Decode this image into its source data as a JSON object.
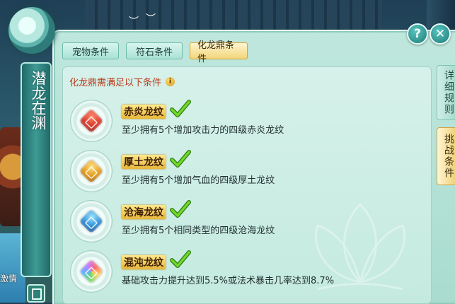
{
  "window": {
    "banner_title": "潜龙在渊"
  },
  "tabs": [
    {
      "label": "宠物条件",
      "active": false
    },
    {
      "label": "符石条件",
      "active": false
    },
    {
      "label": "化龙鼎条件",
      "active": true
    }
  ],
  "side_tabs": [
    {
      "label": "详细规则",
      "active": false
    },
    {
      "label": "挑战条件",
      "active": true
    }
  ],
  "buttons": {
    "help_symbol": "?",
    "close_symbol": "✕"
  },
  "background_text": "激情",
  "heading": {
    "text": "化龙鼎需满足以下条件",
    "info_symbol": "i"
  },
  "conditions": [
    {
      "title": "赤炎龙纹",
      "desc": "至少拥有5个增加攻击力的四级赤炎龙纹",
      "gem_color": "#d8382a",
      "met": true
    },
    {
      "title": "厚土龙纹",
      "desc": "至少拥有5个增加气血的四级厚土龙纹",
      "gem_color": "#e39a16",
      "met": true
    },
    {
      "title": "沧海龙纹",
      "desc": "至少拥有5个相同类型的四级沧海龙纹",
      "gem_color": "#2c8fd8",
      "met": true
    },
    {
      "title": "混沌龙纹",
      "desc": "基础攻击力提升达到5.5%或法术暴击几率达到8.7%",
      "gem_color": "#b66ad8",
      "met": true
    }
  ],
  "colors": {
    "check_green": "#5cc21e",
    "heading_red": "#b83a1a",
    "active_tab_gold": "#f2d47a"
  }
}
